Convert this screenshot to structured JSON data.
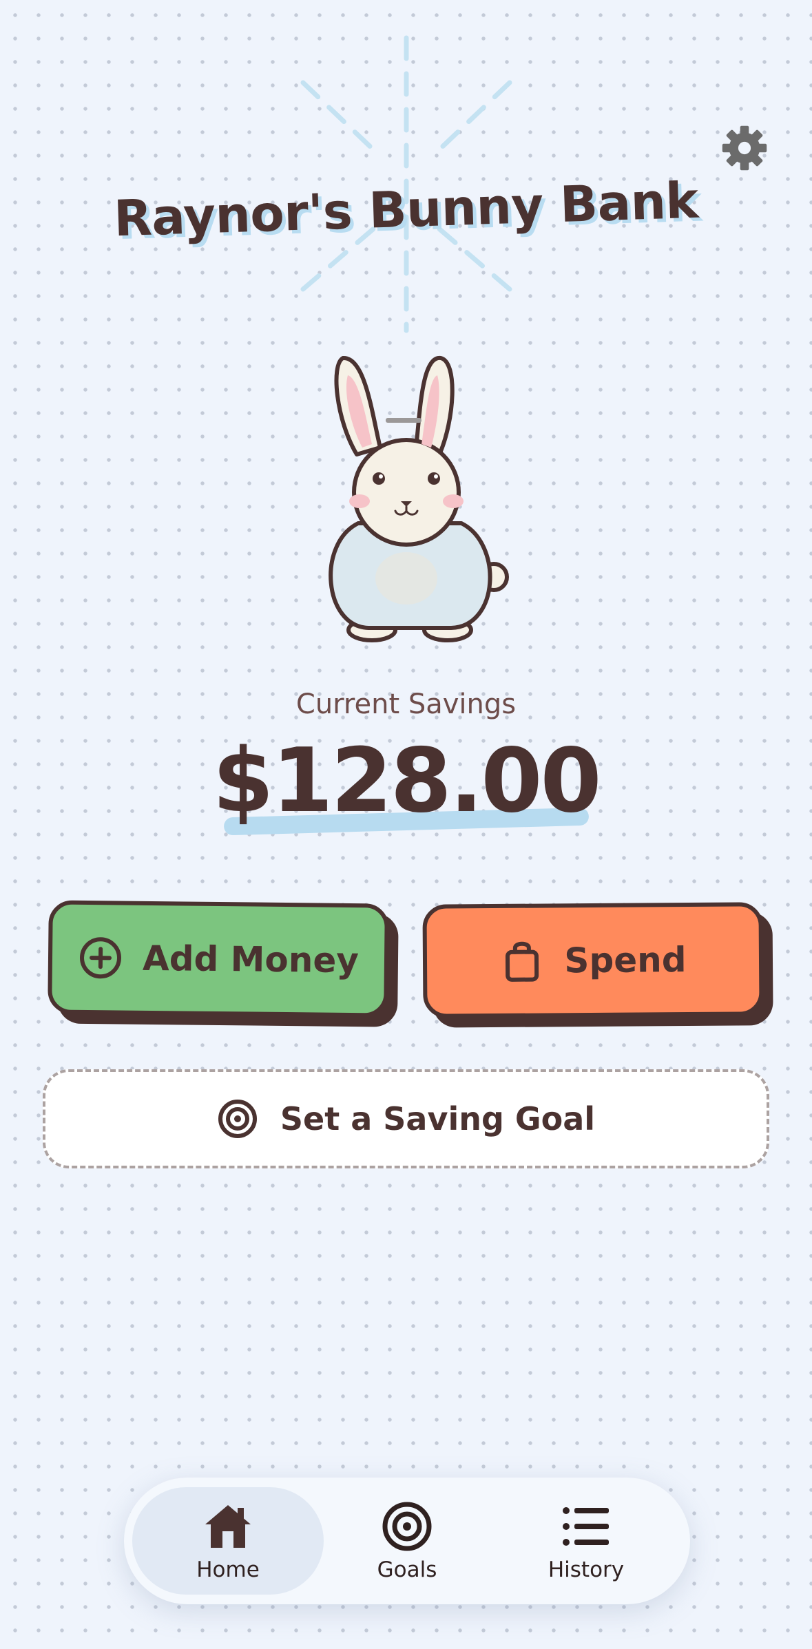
{
  "header": {
    "title": "Raynor's Bunny Bank",
    "settings_icon": "gear-icon"
  },
  "mascot": {
    "icon": "bunny-piggy-bank-illustration"
  },
  "savings": {
    "label": "Current Savings",
    "amount": "$128.00"
  },
  "actions": {
    "add_money": {
      "label": "Add Money",
      "icon": "plus-circle-icon",
      "color": "#7cc57f"
    },
    "spend": {
      "label": "Spend",
      "icon": "shopping-bag-icon",
      "color": "#ff8a5c"
    },
    "saving_goal": {
      "label": "Set a Saving Goal",
      "icon": "target-icon"
    }
  },
  "nav": {
    "items": [
      {
        "label": "Home",
        "icon": "home-icon",
        "active": true
      },
      {
        "label": "Goals",
        "icon": "target-icon",
        "active": false
      },
      {
        "label": "History",
        "icon": "list-icon",
        "active": false
      }
    ]
  },
  "colors": {
    "background": "#eff4fc",
    "ink": "#4a3230",
    "accent_blue": "#b7dbf0"
  }
}
